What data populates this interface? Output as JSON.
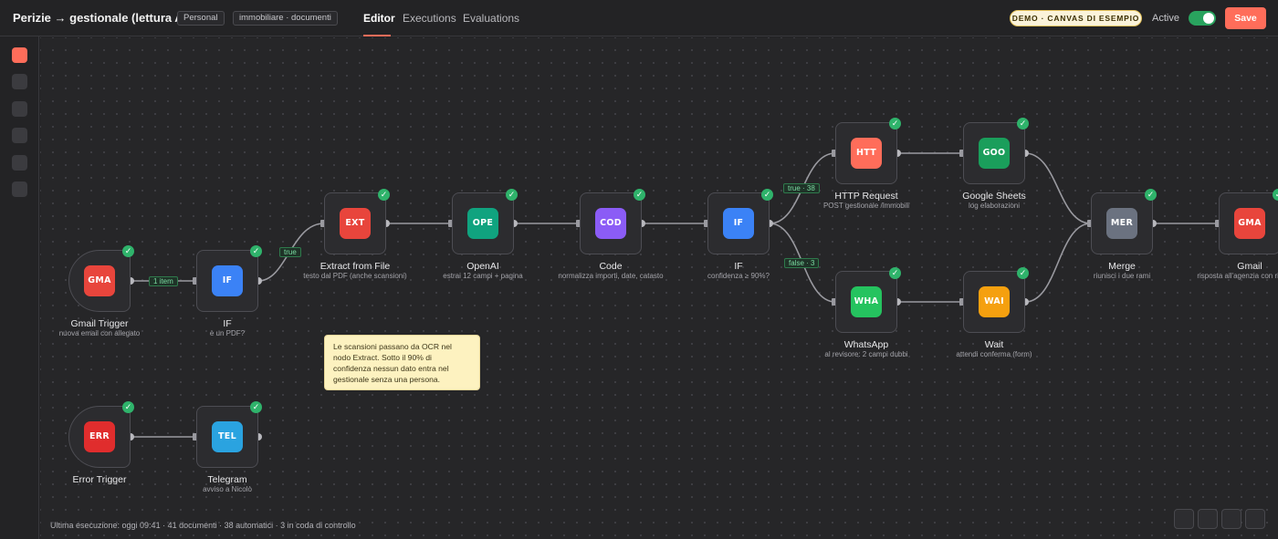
{
  "header": {
    "workflow_title": "Perizie → gestionale (lettura AI)",
    "project_tag": "Personal",
    "labels_tag": "immobiliare · documenti",
    "tabs": [
      {
        "label": "Editor",
        "active": true
      },
      {
        "label": "Executions",
        "active": false
      },
      {
        "label": "Evaluations",
        "active": false
      }
    ],
    "demo_badge": "DEMO · CANVAS DI ESEMPIO",
    "active_label": "Active",
    "active_on": true,
    "save_label": "Save"
  },
  "colors": {
    "accent": "#ff6d5a",
    "success": "#2fb36b",
    "toggle_on": "#29a35e"
  },
  "nodes": {
    "gmail_trigger": {
      "name": "Gmail Trigger",
      "subtitle": "nuova email con allegato",
      "badge": "GMA",
      "color": "#e8453c"
    },
    "if_pdf": {
      "name": "IF",
      "subtitle": "è un PDF?",
      "badge": "IF",
      "color": "#3b82f6"
    },
    "extract": {
      "name": "Extract from File",
      "subtitle": "testo dal PDF (anche scansioni)",
      "badge": "EXT",
      "color": "#e8453c"
    },
    "openai": {
      "name": "OpenAI",
      "subtitle": "estrai 12 campi + pagina",
      "badge": "OPE",
      "color": "#10a37f"
    },
    "code": {
      "name": "Code",
      "subtitle": "normalizza importi, date, catasto",
      "badge": "COD",
      "color": "#8b5cf6"
    },
    "if_conf": {
      "name": "IF",
      "subtitle": "confidenza ≥ 90%?",
      "badge": "IF",
      "color": "#3b82f6"
    },
    "http": {
      "name": "HTTP Request",
      "subtitle": "POST gestionale /immobili",
      "badge": "HTT",
      "color": "#ff6d5a"
    },
    "sheets": {
      "name": "Google Sheets",
      "subtitle": "log elaborazioni",
      "badge": "GOO",
      "color": "#1a9e5b"
    },
    "whatsapp": {
      "name": "WhatsApp",
      "subtitle": "al revisore: 2 campi dubbi",
      "badge": "WHA",
      "color": "#25c35f"
    },
    "wait": {
      "name": "Wait",
      "subtitle": "attendi conferma (form)",
      "badge": "WAI",
      "color": "#f5a00f"
    },
    "merge": {
      "name": "Merge",
      "subtitle": "riunisci i due rami",
      "badge": "MER",
      "color": "#6b7280"
    },
    "gmail_out": {
      "name": "Gmail",
      "subtitle": "risposta all'agenzia con riepilogo",
      "badge": "GMA",
      "color": "#e8453c"
    },
    "error_trigger": {
      "name": "Error Trigger",
      "subtitle": "",
      "badge": "ERR",
      "color": "#e02d2d"
    },
    "telegram": {
      "name": "Telegram",
      "subtitle": "avviso a Nicolò",
      "badge": "TEL",
      "color": "#2aa3e0"
    }
  },
  "edge_labels": {
    "items": "1 item",
    "true": "true",
    "true_count": "true · 38",
    "false_count": "false · 3"
  },
  "sticky_note": "Le scansioni passano da OCR nel nodo Extract. Sotto il 90% di confidenza nessun dato entra nel gestionale senza una persona.",
  "footer": {
    "last_run": "Ultima esecuzione: oggi 09:41 · 41 documenti · 38 automatici · 3 in coda di controllo"
  }
}
